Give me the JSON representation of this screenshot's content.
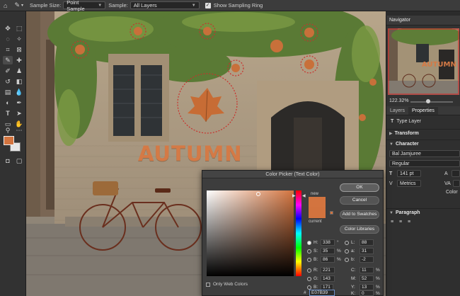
{
  "options_bar": {
    "sample_size_label": "Sample Size:",
    "sample_size_value": "Point Sample",
    "sample_label": "Sample:",
    "sample_value": "All Layers",
    "show_ring_label": "Show Sampling Ring",
    "show_ring_checked": true
  },
  "toolbox": {
    "foreground_color": "#d3743f",
    "background_color": "#e6e6e6"
  },
  "canvas": {
    "text_layer": "AUTUMN"
  },
  "navigator": {
    "title": "Navigator",
    "zoom": "122.32%",
    "thumb_text": "AUTUMN"
  },
  "properties": {
    "tabs": [
      "Layers",
      "Properties"
    ],
    "active_tab": "Properties",
    "layer_type": "Type Layer",
    "sections": {
      "transform": "Transform",
      "character": "Character",
      "paragraph": "Paragraph"
    },
    "font_family": "Bal Jamjuree",
    "font_style": "Regular",
    "font_size": "141 pt",
    "kerning": "Metrics",
    "color_label": "Color"
  },
  "color_picker": {
    "title": "Color Picker (Text Color)",
    "label_new": "new",
    "label_current": "current",
    "new_color": "#d3743f",
    "current_color": "#d2733e",
    "buttons": {
      "ok": "OK",
      "cancel": "Cancel",
      "add_swatches": "Add to Swatches",
      "color_libraries": "Color Libraries"
    },
    "values": {
      "H": "338",
      "S": "35",
      "B": "86",
      "R": "221",
      "G": "143",
      "Bv": "171",
      "L": "88",
      "a": "31",
      "b": "-2",
      "C": "11",
      "M": "52",
      "Y": "13",
      "K": "0"
    },
    "units": {
      "deg": "°",
      "pct": "%"
    },
    "only_web_colors": "Only Web Colors",
    "hex": "E07B39"
  }
}
